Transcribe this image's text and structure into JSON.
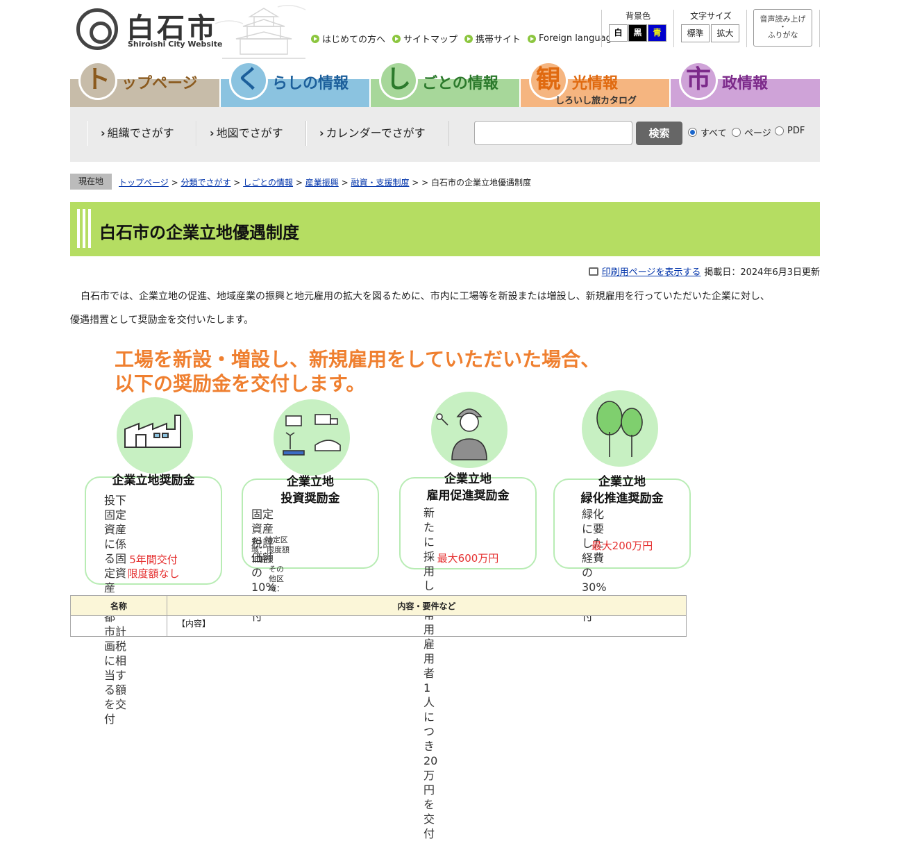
{
  "header": {
    "logo_title": "白石市",
    "logo_subtitle": "Shiroishi City Website",
    "quick_links": [
      "はじめての方へ",
      "サイトマップ",
      "携帯サイト",
      "Foreign language"
    ],
    "bg_color_title": "背景色",
    "bg_colors": [
      {
        "label": "白",
        "bg": "#ffffff",
        "fg": "#000000"
      },
      {
        "label": "黒",
        "bg": "#000000",
        "fg": "#ffffff"
      },
      {
        "label": "青",
        "bg": "#0000cc",
        "fg": "#ffff00"
      }
    ],
    "font_size_title": "文字サイズ",
    "font_sizes": [
      "標準",
      "拡大"
    ],
    "voice_line1": "音声読み上げ",
    "voice_dot": "・",
    "voice_line2": "ふりがな"
  },
  "main_nav": [
    {
      "char": "ト",
      "label": "ップページ",
      "color": "#c7bca9",
      "circle": "#c7bca9",
      "char_color": "#8b5a1e",
      "label_color": "#8b5a1e"
    },
    {
      "char": "く",
      "label": "らしの情報",
      "color": "#8bc3e0",
      "circle": "#8bc3e0",
      "char_color": "#1c5f9b",
      "label_color": "#1c5f9b"
    },
    {
      "char": "し",
      "label": "ごとの情報",
      "color": "#a7d79a",
      "circle": "#a7d79a",
      "char_color": "#2c7a2c",
      "label_color": "#2c7a2c"
    },
    {
      "char": "観",
      "label": "光情報",
      "sublabel": "しろいし旅カタログ",
      "color": "#f5b580",
      "circle": "#f5b580",
      "char_color": "#e06a10",
      "label_color": "#e06a10"
    },
    {
      "char": "市",
      "label": "政情報",
      "color": "#cfa3d8",
      "circle": "#cfa3d8",
      "char_color": "#7c2a8a",
      "label_color": "#7c2a8a"
    }
  ],
  "sub_nav": {
    "items": [
      "組織でさがす",
      "地図でさがす",
      "カレンダーでさがす"
    ],
    "search_button": "検索",
    "search_placeholder": "",
    "radios": [
      "すべて",
      "ページ",
      "PDF"
    ]
  },
  "breadcrumb": {
    "tag": "現在地",
    "links": [
      "トップページ",
      "分類でさがす",
      "しごとの情報",
      "産業振興",
      "融資・支援制度"
    ],
    "current": "白石市の企業立地優遇制度"
  },
  "page": {
    "title": "白石市の企業立地優遇制度",
    "print_link": "印刷用ページを表示する",
    "posted": "掲載日：2024年6月3日更新",
    "intro_line1": "白石市では、企業立地の促進、地域産業の振興と地元雇用の拡大を図るために、市内に工場等を新設または増設し、新規雇用を行っていただいた企業に対し、",
    "intro_line2": "優遇措置として奨励金を交付いたします。"
  },
  "infographic": {
    "heading_line1": "工場を新設・増設し、新規雇用をしていただいた場合、",
    "heading_line2": "以下の奨励金を交付します。",
    "awards": [
      {
        "name": [
          "企業立地奨励金"
        ],
        "desc": [
          "投下固定資産に係",
          "る固定資産税・都",
          "市計画税に相当す",
          "る額を交付"
        ],
        "red": [
          "5年間交付",
          "限度額なし"
        ]
      },
      {
        "name": [
          "企業立地",
          "投資奨励金"
        ],
        "desc": [
          "固定資産税評価額の",
          "10%を交付"
        ],
        "note": [
          "※1 特定区域：限度額1億円",
          "その他区域：2,000万円"
        ]
      },
      {
        "name": [
          "企業立地",
          "雇用促進奨励金"
        ],
        "desc": [
          "新たに採用した常",
          "用雇用者1人につ",
          "き20万円を交付"
        ],
        "red": [
          "最大600万円"
        ]
      },
      {
        "name": [
          "企業立地",
          "緑化推進奨励金"
        ],
        "desc": [
          "緑化に要した経費",
          "の30%を交付"
        ],
        "red": [
          "最大200万円"
        ]
      }
    ]
  },
  "table": {
    "headers": [
      "名称",
      "内容・要件など"
    ],
    "row1_content": "【内容】"
  }
}
